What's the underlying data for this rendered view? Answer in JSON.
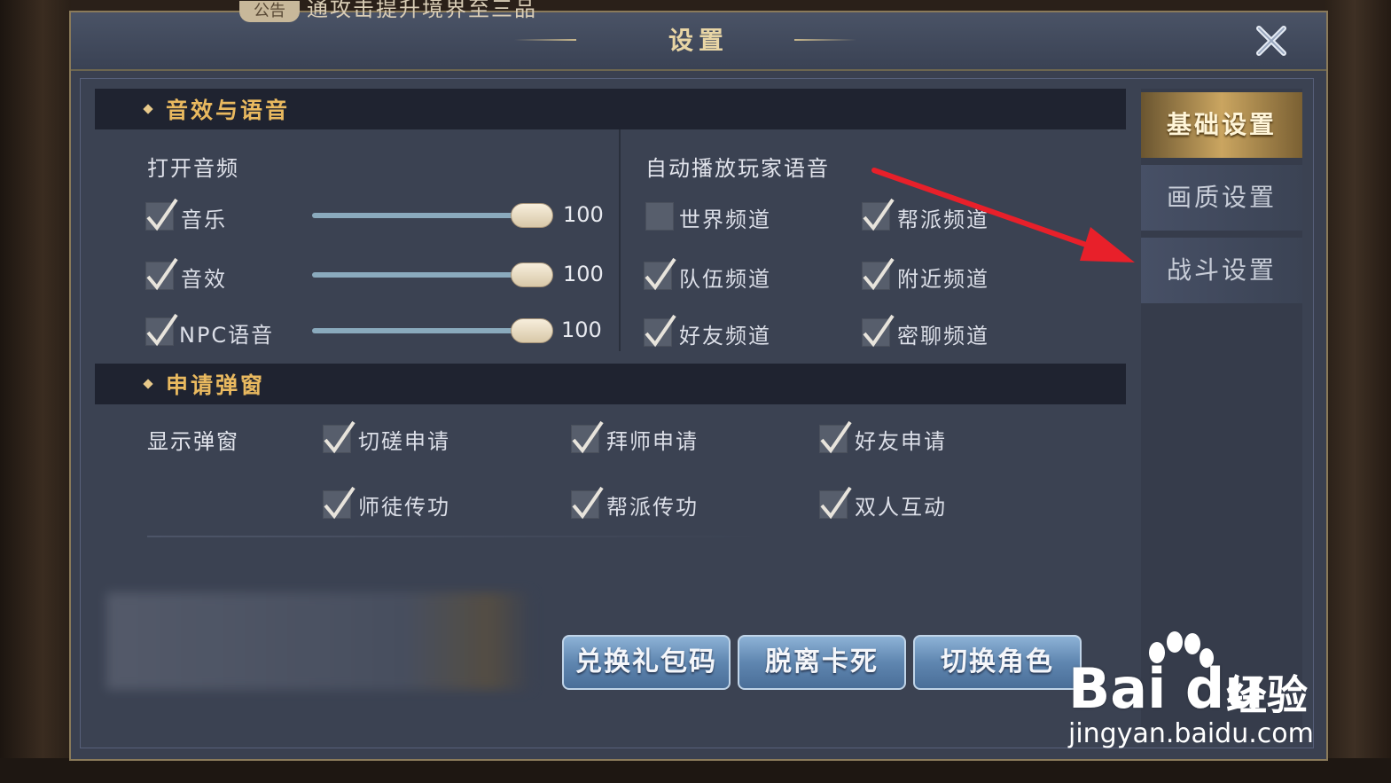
{
  "notice": {
    "tag": "公告",
    "text": "通攻击提升境界至三品"
  },
  "dialog": {
    "title": "设置"
  },
  "sections": {
    "audio": {
      "title": "音效与语音",
      "open_audio_label": "打开音频",
      "items": [
        {
          "label": "音乐",
          "checked": true,
          "value": 100
        },
        {
          "label": "音效",
          "checked": true,
          "value": 100
        },
        {
          "label": "NPC语音",
          "checked": true,
          "value": 100
        }
      ],
      "auto_voice_label": "自动播放玩家语音",
      "channels": [
        {
          "label": "世界频道",
          "checked": false
        },
        {
          "label": "帮派频道",
          "checked": true
        },
        {
          "label": "队伍频道",
          "checked": true
        },
        {
          "label": "附近频道",
          "checked": true
        },
        {
          "label": "好友频道",
          "checked": true
        },
        {
          "label": "密聊频道",
          "checked": true
        }
      ]
    },
    "popup": {
      "title": "申请弹窗",
      "show_label": "显示弹窗",
      "items": [
        {
          "label": "切磋申请",
          "checked": true
        },
        {
          "label": "拜师申请",
          "checked": true
        },
        {
          "label": "好友申请",
          "checked": true
        },
        {
          "label": "师徒传功",
          "checked": true
        },
        {
          "label": "帮派传功",
          "checked": true
        },
        {
          "label": "双人互动",
          "checked": true
        }
      ]
    }
  },
  "actions": [
    "兑换礼包码",
    "脱离卡死",
    "切换角色"
  ],
  "side_tabs": [
    {
      "label": "基础设置",
      "active": true
    },
    {
      "label": "画质设置",
      "active": false
    },
    {
      "label": "战斗设置",
      "active": false
    }
  ],
  "watermark": {
    "logo": "Bai du",
    "suffix": "经验",
    "url": "jingyan.baidu.com"
  },
  "colors": {
    "accent_gold": "#e9b95f",
    "arrow": "#e8202a",
    "button_blue": "#5f86b0"
  }
}
